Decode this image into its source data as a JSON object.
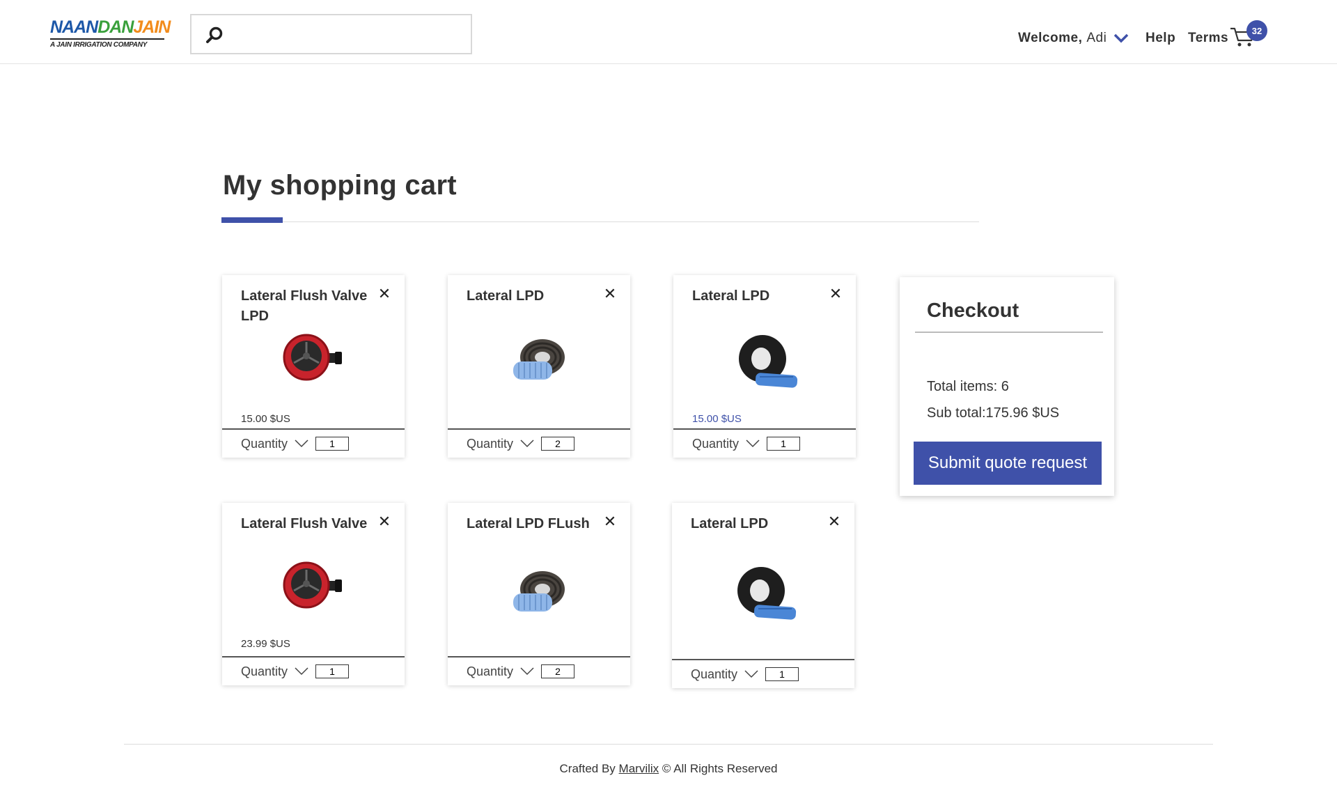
{
  "header": {
    "logo": {
      "part1": "NAAN",
      "part2": "DAN",
      "part3": "JAIN",
      "tagline": "A JAIN IRRIGATION COMPANY"
    },
    "search": {
      "placeholder": "",
      "value": ""
    },
    "nav": {
      "welcome_prefix": "Welcome,",
      "user_name": "Adi",
      "help": "Help",
      "terms": "Terms",
      "cart_count": "32"
    }
  },
  "page": {
    "title": "My shopping cart"
  },
  "cart_items": [
    {
      "name": "Lateral Flush Valve LPD",
      "price": "15.00 $US",
      "quantity_label": "Quantity",
      "quantity": "1",
      "image": "flush-valve"
    },
    {
      "name": "Lateral LPD",
      "price": "",
      "quantity_label": "Quantity",
      "quantity": "2",
      "image": "pipe-coil-brown"
    },
    {
      "name": "Lateral LPD",
      "price": "15.00 $US",
      "quantity_label": "Quantity",
      "quantity": "1",
      "image": "pipe-coil-black"
    },
    {
      "name": "Lateral Flush Valve",
      "price": "23.99 $US",
      "quantity_label": "Quantity",
      "quantity": "1",
      "image": "flush-valve"
    },
    {
      "name": "Lateral LPD FLush",
      "price": "",
      "quantity_label": "Quantity",
      "quantity": "2",
      "image": "pipe-coil-brown"
    },
    {
      "name": "Lateral LPD",
      "price": "",
      "quantity_label": "Quantity",
      "quantity": "1",
      "image": "pipe-coil-black"
    }
  ],
  "checkout": {
    "title": "Checkout",
    "total_items": "Total items: 6",
    "sub_total": "Sub total:175.96 $US",
    "submit_label": "Submit quote request"
  },
  "footer": {
    "prefix": "Crafted By",
    "link": "Marvilix",
    "suffix": "© All Rights Reserved"
  },
  "colors": {
    "accent": "#3f51a9",
    "text": "#333333"
  }
}
